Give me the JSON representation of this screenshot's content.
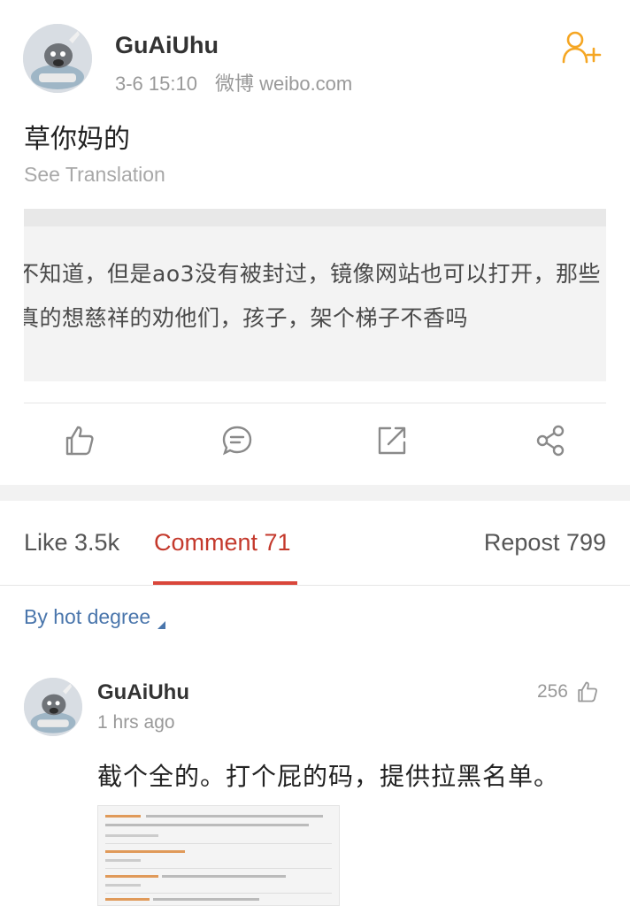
{
  "post": {
    "username": "GuAiUhu",
    "time": "3-6 15:10",
    "source": "微博 weibo.com",
    "text": "草你妈的",
    "see_translation": "See Translation",
    "quote_image": {
      "line1": "不知道，但是ao3没有被封过，镜像网站也可以打开，那些",
      "line2": "真的想慈祥的劝他们，孩子，架个梯子不香吗"
    }
  },
  "tabs": {
    "like": "Like 3.5k",
    "comment": "Comment 71",
    "repost": "Repost 799"
  },
  "sort_label": "By hot degree",
  "comment": {
    "username": "GuAiUhu",
    "time": "1 hrs ago",
    "likes": "256",
    "text": "截个全的。打个屁的码，提供拉黑名单。"
  },
  "icons": {
    "follow": "add-user-icon",
    "like": "thumbs-up-icon",
    "comment": "comment-bubble-icon",
    "repost": "repost-arrow-icon",
    "share": "share-icon"
  },
  "colors": {
    "accent_orange": "#f5a623",
    "tab_active": "#c4392c",
    "link_blue": "#4a76ac"
  }
}
